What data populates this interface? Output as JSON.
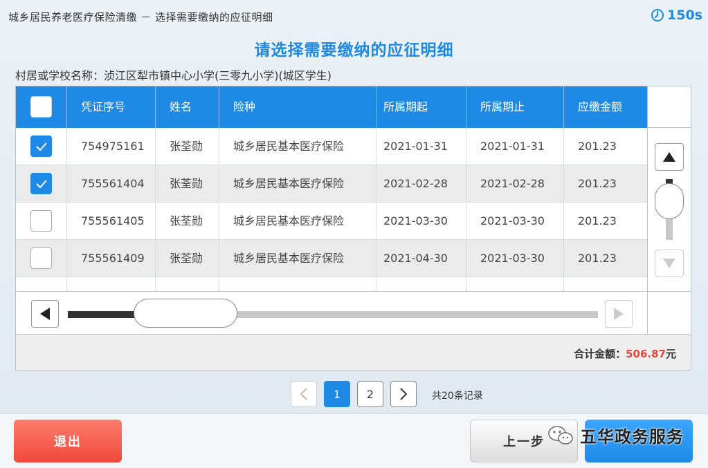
{
  "app_title": "城乡居民养老医疗保险清缴  －  选择需要缴纳的应征明细",
  "timer": "150s",
  "heading": "请选择需要缴纳的应征明细",
  "school_label": "村居或学校名称：",
  "school_name": "浈江区犁市镇中心小学(三零九小学)(城区学生)",
  "table": {
    "headers": [
      "凭证序号",
      "姓名",
      "险种",
      "所属期起",
      "所属期止",
      "应缴金额"
    ],
    "rows": [
      {
        "checked": true,
        "voucher": "754975161",
        "name": "张荃勋",
        "type": "城乡居民基本医疗保险",
        "start": "2021-01-31",
        "end": "2021-01-31",
        "amount": "201.23"
      },
      {
        "checked": true,
        "voucher": "755561404",
        "name": "张荃勋",
        "type": "城乡居民基本医疗保险",
        "start": "2021-02-28",
        "end": "2021-02-28",
        "amount": "201.23"
      },
      {
        "checked": false,
        "voucher": "755561405",
        "name": "张荃勋",
        "type": "城乡居民基本医疗保险",
        "start": "2021-03-30",
        "end": "2021-03-30",
        "amount": "201.23"
      },
      {
        "checked": false,
        "voucher": "755561409",
        "name": "张荃勋",
        "type": "城乡居民基本医疗保险",
        "start": "2021-04-30",
        "end": "2021-03-30",
        "amount": "201.23"
      }
    ]
  },
  "total": {
    "label": "合计金额：",
    "amount": "506.87",
    "unit": "元"
  },
  "pager": {
    "pages": [
      "1",
      "2"
    ],
    "active": "1",
    "records": "共20条记录"
  },
  "buttons": {
    "exit": "退出",
    "prev": "上一步"
  },
  "watermark": "五华政务服务",
  "colors": {
    "primary": "#1e8ae6",
    "danger": "#f0473b",
    "amount": "#e8453c"
  }
}
